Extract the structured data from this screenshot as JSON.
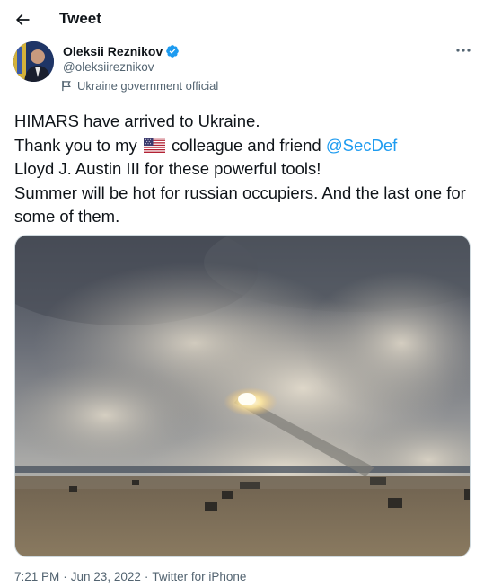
{
  "header": {
    "title": "Tweet",
    "back_icon": "arrow-left-icon"
  },
  "author": {
    "name": "Oleksii Reznikov",
    "handle": "@oleksiireznikov",
    "verified": true,
    "label": "Ukraine government official",
    "label_icon": "flag-icon"
  },
  "tweet": {
    "line1": "HIMARS have arrived to Ukraine.",
    "line2_pre": "Thank you to my",
    "line2_flag": "us-flag-emoji",
    "line2_post": "colleague and friend",
    "mention": "@SecDef",
    "line3": "Lloyd J. Austin III for these powerful tools!",
    "line4": "Summer will be hot for russian occupiers. And the last one for some of them."
  },
  "meta": {
    "time": "7:21 PM",
    "sep1": "·",
    "date": "Jun 23, 2022",
    "sep2": "·",
    "source": "Twitter for iPhone"
  },
  "colors": {
    "accent": "#1d9bf0",
    "text": "#0f1419",
    "muted": "#536471"
  }
}
